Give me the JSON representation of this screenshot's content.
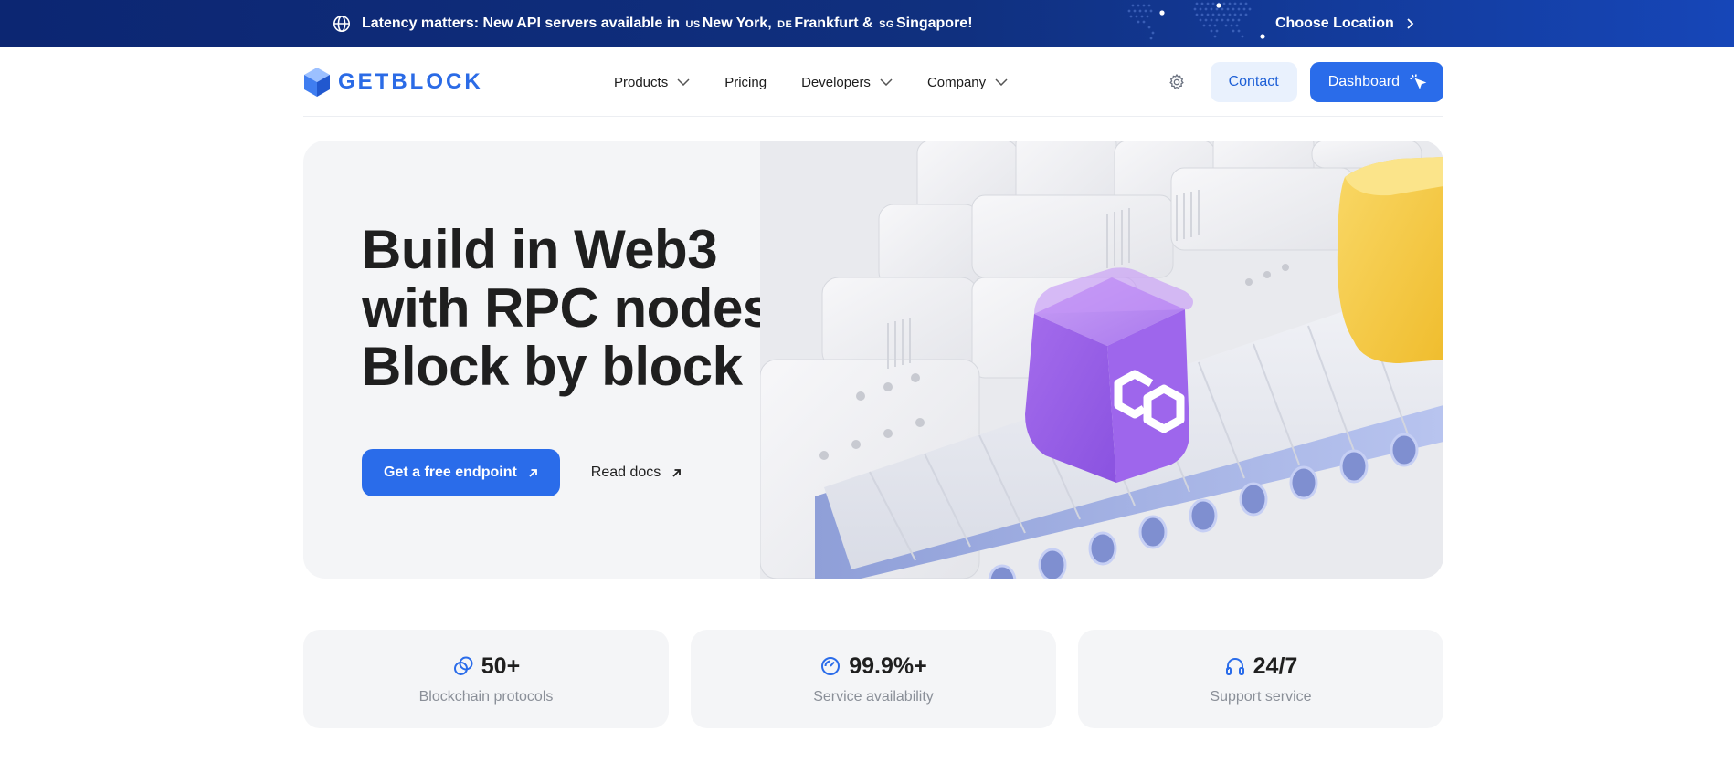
{
  "banner": {
    "prefix": "Latency matters: New API servers available in",
    "loc1_code": "us",
    "loc1_city": "New York,",
    "loc2_code": "de",
    "loc2_city": "Frankfurt &",
    "loc3_code": "sg",
    "loc3_city": "Singapore!",
    "choose_location": "Choose Location"
  },
  "nav": {
    "logo_text": "GETBLOCK",
    "items": [
      {
        "label": "Products",
        "has_dropdown": true
      },
      {
        "label": "Pricing",
        "has_dropdown": false
      },
      {
        "label": "Developers",
        "has_dropdown": true
      },
      {
        "label": "Company",
        "has_dropdown": true
      }
    ],
    "contact": "Contact",
    "dashboard": "Dashboard"
  },
  "hero": {
    "title_lines": [
      "Build in Web3",
      "with RPC nodes.",
      "Block by block"
    ],
    "primary_cta": "Get a free endpoint",
    "secondary_cta": "Read docs"
  },
  "stats": [
    {
      "value": "50+",
      "label": "Blockchain protocols",
      "icon": "link-circles-icon"
    },
    {
      "value": "99.9%+",
      "label": "Service availability",
      "icon": "speedometer-icon"
    },
    {
      "value": "24/7",
      "label": "Support service",
      "icon": "headphones-icon"
    }
  ],
  "colors": {
    "brand_blue": "#2a6cea",
    "banner_dark": "#0c2672",
    "cube_purple": "#9b5de5",
    "cube_yellow": "#f5c842"
  }
}
